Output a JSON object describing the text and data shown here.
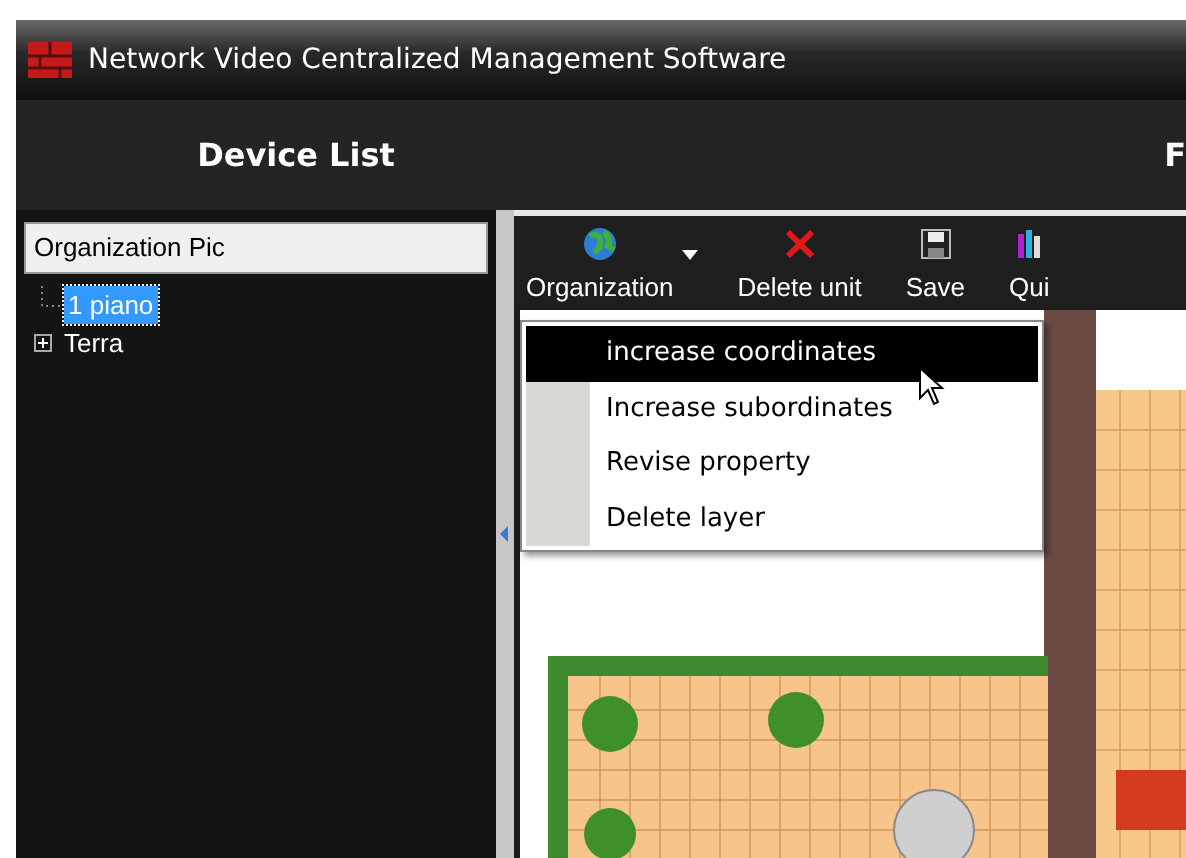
{
  "window": {
    "title": "Network Video Centralized Management Software"
  },
  "left_header": "Device List",
  "right_header": "F",
  "organization_field": {
    "value": "Organization Pic"
  },
  "tree": [
    {
      "kind": "leaf",
      "label": "1 piano",
      "selected": true
    },
    {
      "kind": "branch",
      "label": "Terra",
      "selected": false,
      "expanded": false
    }
  ],
  "toolbar": [
    {
      "kind": "globe",
      "label": "Organization",
      "dropdown": true
    },
    {
      "kind": "delete",
      "label": "Delete unit",
      "dropdown": false
    },
    {
      "kind": "save",
      "label": "Save",
      "dropdown": false
    },
    {
      "kind": "quit",
      "label": "Qui",
      "dropdown": false
    }
  ],
  "menu": [
    {
      "label": "increase coordinates",
      "selected": true
    },
    {
      "label": "Increase subordinates",
      "selected": false
    },
    {
      "label": "Revise property",
      "selected": false
    },
    {
      "label": "Delete layer",
      "selected": false
    }
  ]
}
